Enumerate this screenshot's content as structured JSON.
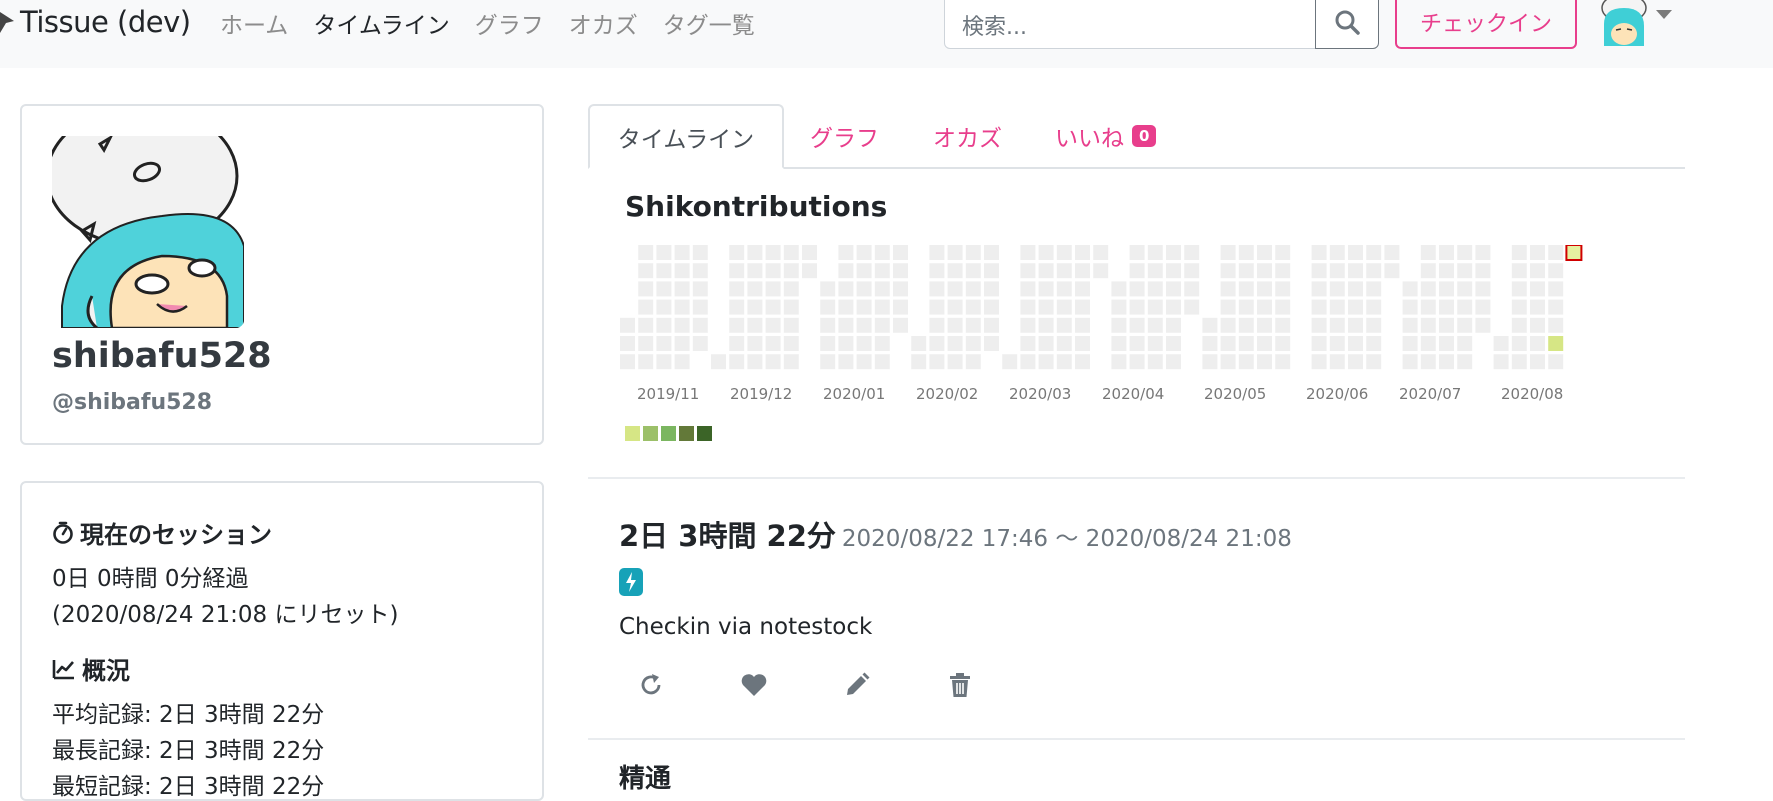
{
  "navbar": {
    "brand": "Tissue (dev)",
    "links": [
      "ホーム",
      "タイムライン",
      "グラフ",
      "オカズ",
      "タグ一覧"
    ],
    "active_link": "タイムライン",
    "search_placeholder": "検索...",
    "checkin_label": "チェックイン"
  },
  "profile": {
    "display_name": "shibafu528",
    "handle": "@shibafu528"
  },
  "stats": {
    "session_title": "現在のセッション",
    "session_elapsed": "0日 0時間 0分経過",
    "session_reset": "(2020/08/24 21:08 にリセット)",
    "overview_title": "概況",
    "average": "平均記録: 2日 3時間 22分",
    "longest": "最長記録: 2日 3時間 22分",
    "shortest": "最短記録: 2日 3時間 22分"
  },
  "tabs": {
    "timeline": "タイムライン",
    "graph": "グラフ",
    "okazu": "オカズ",
    "likes": "いいね",
    "likes_count": "0"
  },
  "contributions": {
    "title": "Shikontributions",
    "months": [
      "2019/11",
      "2019/12",
      "2020/01",
      "2020/02",
      "2020/03",
      "2020/04",
      "2020/05",
      "2020/06",
      "2020/07",
      "2020/08"
    ],
    "legend_colors": [
      "#d6e685",
      "#9cc069",
      "#7bb660",
      "#637939",
      "#3b6427"
    ],
    "empty_color": "#eeeeee",
    "active_days": [
      {
        "date": "2020-08-22",
        "level": 1
      },
      {
        "date": "2020-08-24",
        "level": 0,
        "today": true
      }
    ],
    "today_border": "#d00000"
  },
  "checkin": {
    "duration": "2日 3時間 22分",
    "period": "2020/08/22 17:46 〜 2020/08/24 21:08",
    "note": "Checkin via notestock",
    "next_heading": "精通"
  },
  "colors": {
    "accent": "#e83e8c",
    "app_badge": "#17a2b8"
  }
}
